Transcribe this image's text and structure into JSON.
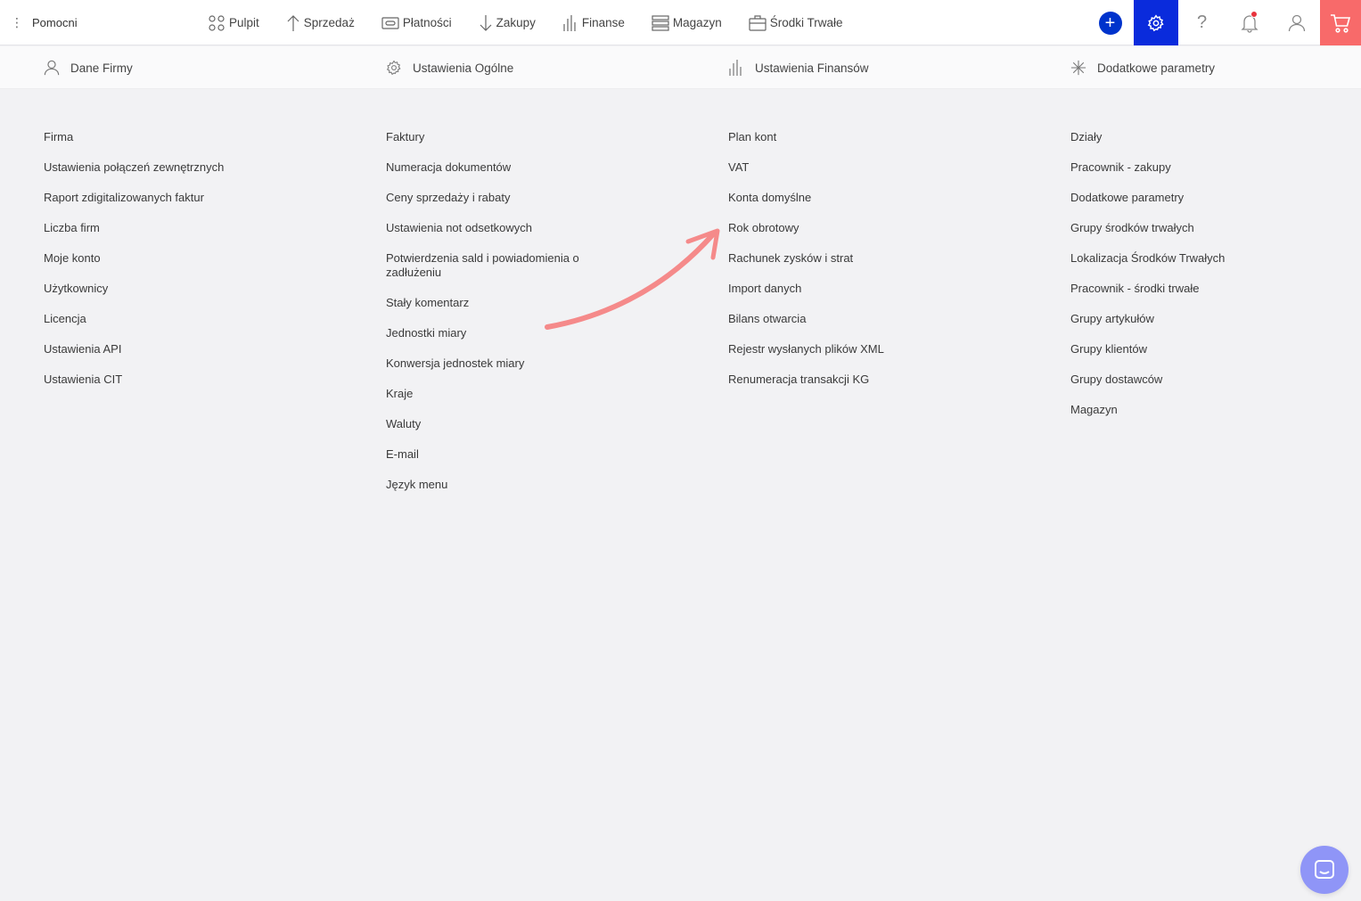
{
  "brand": {
    "label": "Pomocni"
  },
  "nav": [
    {
      "label": "Pulpit",
      "icon": "dashboard-icon"
    },
    {
      "label": "Sprzedaż",
      "icon": "arrow-up-icon"
    },
    {
      "label": "Płatności",
      "icon": "payment-icon"
    },
    {
      "label": "Zakupy",
      "icon": "arrow-down-icon"
    },
    {
      "label": "Finanse",
      "icon": "finance-icon"
    },
    {
      "label": "Magazyn",
      "icon": "warehouse-icon"
    },
    {
      "label": "Środki Trwałe",
      "icon": "briefcase-icon"
    }
  ],
  "subtabs": [
    {
      "label": "Dane Firmy",
      "icon": "user-icon"
    },
    {
      "label": "Ustawienia Ogólne",
      "icon": "gear-icon"
    },
    {
      "label": "Ustawienia Finansów",
      "icon": "finance-icon"
    },
    {
      "label": "Dodatkowe parametry",
      "icon": "asterisk-icon"
    }
  ],
  "columns": [
    {
      "links": [
        "Firma",
        "Ustawienia połączeń zewnętrznych",
        "Raport zdigitalizowanych faktur",
        "Liczba firm",
        "Moje konto",
        "Użytkownicy",
        "Licencja",
        "Ustawienia API",
        "Ustawienia CIT"
      ]
    },
    {
      "links": [
        "Faktury",
        "Numeracja dokumentów",
        "Ceny sprzedaży i rabaty",
        "Ustawienia not odsetkowych",
        "Potwierdzenia sald i powiadomienia o zadłużeniu",
        "Stały komentarz",
        "Jednostki miary",
        "Konwersja jednostek miary",
        "Kraje",
        "Waluty",
        "E-mail",
        "Język menu"
      ]
    },
    {
      "links": [
        "Plan kont",
        "VAT",
        "Konta domyślne",
        "Rok obrotowy",
        "Rachunek zysków i strat",
        "Import danych",
        "Bilans otwarcia",
        "Rejestr wysłanych plików XML",
        "Renumeracja transakcji KG"
      ]
    },
    {
      "links": [
        "Działy",
        "Pracownik - zakupy",
        "Dodatkowe parametry",
        "Grupy środków trwałych",
        "Lokalizacja Środków Trwałych",
        "Pracownik - środki trwałe",
        "Grupy artykułów",
        "Grupy klientów",
        "Grupy dostawców",
        "Magazyn"
      ]
    }
  ],
  "colors": {
    "accent": "#0a2bdc",
    "add": "#0033cc",
    "cart": "#f86a6a",
    "annotation": "#f58a8a",
    "chat": "#8f95f7",
    "notification": "#e8333d"
  }
}
